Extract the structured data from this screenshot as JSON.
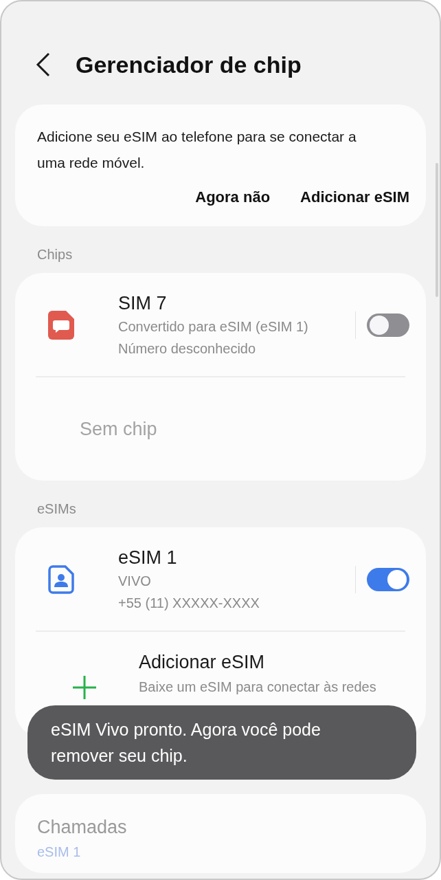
{
  "header": {
    "title": "Gerenciador de chip"
  },
  "prompt_card": {
    "message": "Adicione seu eSIM ao telefone para se conectar a uma rede móvel.",
    "buttons": [
      "Agora não",
      "Adicionar eSIM"
    ]
  },
  "chips_section": {
    "label": "Chips",
    "items": [
      {
        "kind": "sim",
        "title": "SIM 7",
        "lines": [
          "Convertido para eSIM (eSIM 1)",
          "Número desconhecido"
        ],
        "on": false
      },
      {
        "kind": "empty",
        "title": "Sem chip"
      }
    ]
  },
  "esims_section": {
    "label": "eSIMs",
    "items": [
      {
        "kind": "esim",
        "title": "eSIM 1",
        "lines": [
          "VIVO",
          "+55 (11) XXXXX-XXXX"
        ],
        "on": true
      },
      {
        "kind": "add",
        "title": "Adicionar eSIM",
        "lines": [
          "Baixe um eSIM para conectar às redes"
        ]
      }
    ]
  },
  "preferred_card": {
    "title": "Chamadas",
    "value": "eSIM 1"
  },
  "toast": {
    "message": "eSIM Vivo pronto. Agora você pode remover seu chip."
  }
}
